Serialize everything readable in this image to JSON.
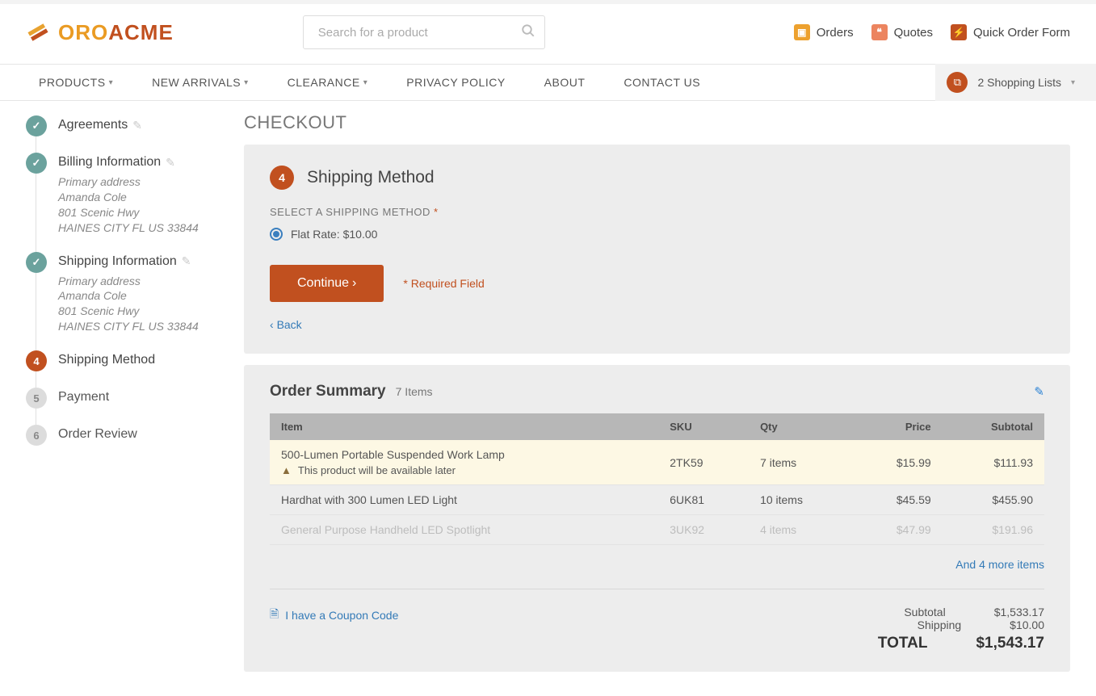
{
  "brand": {
    "oro": "ORO",
    "acme": "ACME"
  },
  "search": {
    "placeholder": "Search for a product"
  },
  "header_links": {
    "orders": "Orders",
    "quotes": "Quotes",
    "quick_order": "Quick Order Form"
  },
  "nav": {
    "products": "PRODUCTS",
    "new_arrivals": "NEW ARRIVALS",
    "clearance": "CLEARANCE",
    "privacy": "PRIVACY POLICY",
    "about": "ABOUT",
    "contact": "CONTACT US",
    "shopping_lists": "2 Shopping Lists"
  },
  "checkout": {
    "title": "CHECKOUT",
    "steps": {
      "agreements": {
        "label": "Agreements"
      },
      "billing": {
        "label": "Billing Information",
        "addr1": "Primary address",
        "addr2": "Amanda Cole",
        "addr3": "801 Scenic Hwy",
        "addr4": "HAINES CITY FL US 33844"
      },
      "shipping_info": {
        "label": "Shipping Information",
        "addr1": "Primary address",
        "addr2": "Amanda Cole",
        "addr3": "801 Scenic Hwy",
        "addr4": "HAINES CITY FL US 33844"
      },
      "shipping_method": {
        "badge": "4",
        "label": "Shipping Method"
      },
      "payment": {
        "badge": "5",
        "label": "Payment"
      },
      "review": {
        "badge": "6",
        "label": "Order Review"
      }
    },
    "panel": {
      "badge": "4",
      "title": "Shipping Method",
      "select_label": "SELECT A SHIPPING METHOD",
      "option1": "Flat Rate: $10.00",
      "continue": "Continue",
      "required": "* Required Field",
      "back": "Back"
    }
  },
  "summary": {
    "title": "Order Summary",
    "items_label": "7 Items",
    "cols": {
      "item": "Item",
      "sku": "SKU",
      "qty": "Qty",
      "price": "Price",
      "subtotal": "Subtotal"
    },
    "rows": [
      {
        "name": "500-Lumen Portable Suspended Work Lamp",
        "warn": "This product will be available later",
        "sku": "2TK59",
        "qty": "7 items",
        "price": "$15.99",
        "subtotal": "$111.93"
      },
      {
        "name": "Hardhat with 300 Lumen LED Light",
        "sku": "6UK81",
        "qty": "10 items",
        "price": "$45.59",
        "subtotal": "$455.90"
      },
      {
        "name": "General Purpose Handheld LED Spotlight",
        "sku": "3UK92",
        "qty": "4 items",
        "price": "$47.99",
        "subtotal": "$191.96"
      }
    ],
    "more": "And 4 more items",
    "coupon": "I have a Coupon Code",
    "totals": {
      "subtotal_label": "Subtotal",
      "subtotal": "$1,533.17",
      "shipping_label": "Shipping",
      "shipping": "$10.00",
      "total_label": "TOTAL",
      "total": "$1,543.17"
    }
  }
}
